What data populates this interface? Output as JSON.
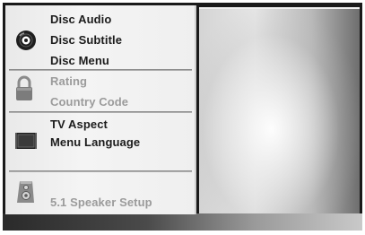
{
  "menu": {
    "groups": [
      {
        "icon": "disc-icon",
        "items": [
          {
            "label": "Disc Audio"
          },
          {
            "label": "Disc Subtitle"
          },
          {
            "label": "Disc Menu"
          }
        ]
      },
      {
        "icon": "lock-icon",
        "items": [
          {
            "label": "Rating"
          },
          {
            "label": "Country Code"
          }
        ]
      },
      {
        "icon": "tv-screen-icon",
        "items": [
          {
            "label": "TV Aspect"
          },
          {
            "label": "Menu Language"
          }
        ]
      },
      {
        "icon": "speaker-icon",
        "items": [
          {
            "label": "5.1 Speaker Setup"
          }
        ]
      }
    ]
  },
  "colors": {
    "active_text": "#1c1c1c",
    "dim_text": "#9b9b9b",
    "panel_bg": "#efefef",
    "frame": "#1a1a1a"
  }
}
